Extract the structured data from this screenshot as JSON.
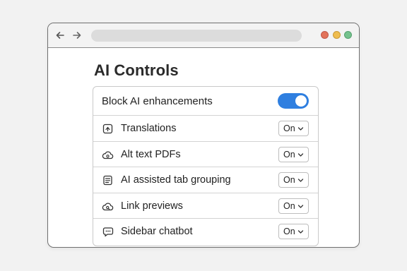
{
  "page": {
    "title": "AI Controls"
  },
  "window_controls": [
    "close",
    "minimize",
    "maximize"
  ],
  "main_toggle": {
    "label": "Block AI enhancements",
    "state": "on",
    "color": "#2f7fe0"
  },
  "items": [
    {
      "label": "Translations",
      "icon": "translate-icon",
      "value": "On"
    },
    {
      "label": "Alt text PDFs",
      "icon": "cloud-icon",
      "value": "On"
    },
    {
      "label": "AI assisted tab grouping",
      "icon": "tabs-icon",
      "value": "On"
    },
    {
      "label": "Link previews",
      "icon": "cloud-search-icon",
      "value": "On"
    },
    {
      "label": "Sidebar chatbot",
      "icon": "chat-icon",
      "value": "On"
    }
  ]
}
